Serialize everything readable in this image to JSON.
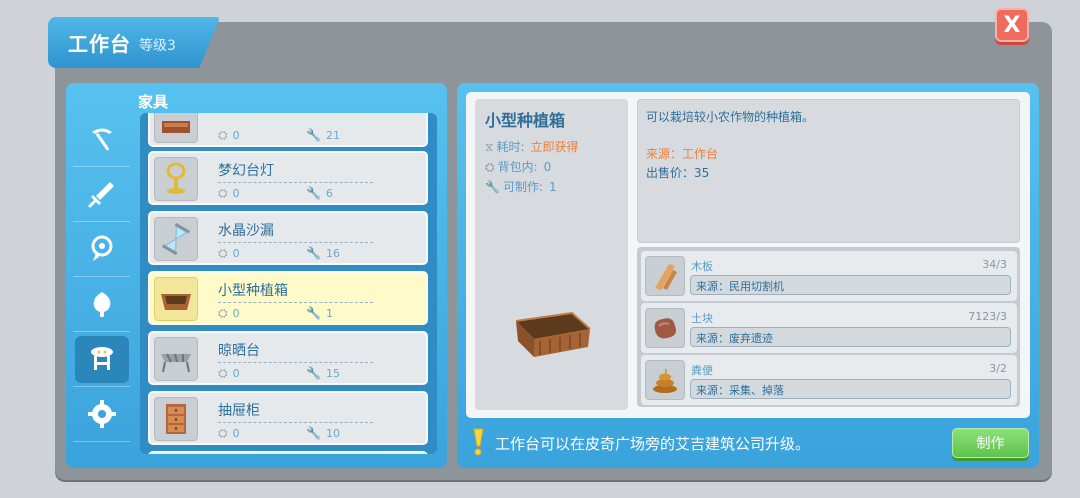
{
  "window": {
    "title": "工作台",
    "level": "等级3"
  },
  "close_label": "X",
  "category": "家具",
  "side_tabs": [
    {
      "icon": "pickaxe-icon"
    },
    {
      "icon": "sword-icon"
    },
    {
      "icon": "food-icon"
    },
    {
      "icon": "potion-icon"
    },
    {
      "icon": "furniture-icon"
    },
    {
      "icon": "gear-icon"
    }
  ],
  "items": [
    {
      "name": "",
      "bag": "0",
      "craftable": "21",
      "icon": "bed-icon"
    },
    {
      "name": "梦幻台灯",
      "bag": "0",
      "craftable": "6",
      "icon": "lamp-icon"
    },
    {
      "name": "水晶沙漏",
      "bag": "0",
      "craftable": "16",
      "icon": "hourglass-icon"
    },
    {
      "name": "小型种植箱",
      "bag": "0",
      "craftable": "1",
      "icon": "planter-icon"
    },
    {
      "name": "晾晒台",
      "bag": "0",
      "craftable": "15",
      "icon": "drying-rack-icon"
    },
    {
      "name": "抽屉柜",
      "bag": "0",
      "craftable": "10",
      "icon": "drawer-icon"
    }
  ],
  "detail": {
    "name": "小型种植箱",
    "time_label": "耗时:",
    "time_value": "立即获得",
    "bag_label": "背包内:",
    "bag_value": "0",
    "craft_label": "可制作:",
    "craft_value": "1",
    "description": "可以栽培较小农作物的种植箱。",
    "source": "来源：工作台",
    "price": "出售价：35"
  },
  "materials": [
    {
      "name": "木板",
      "qty": "34/3",
      "source": "来源：民用切割机",
      "icon": "plank-icon"
    },
    {
      "name": "土块",
      "qty": "7123/3",
      "source": "来源：废弃遗迹",
      "icon": "dirt-icon"
    },
    {
      "name": "粪便",
      "qty": "3/2",
      "source": "来源：采集、掉落",
      "icon": "manure-icon"
    }
  ],
  "tip": "工作台可以在皮奇广场旁的艾吉建筑公司升级。",
  "make_button": "制作"
}
